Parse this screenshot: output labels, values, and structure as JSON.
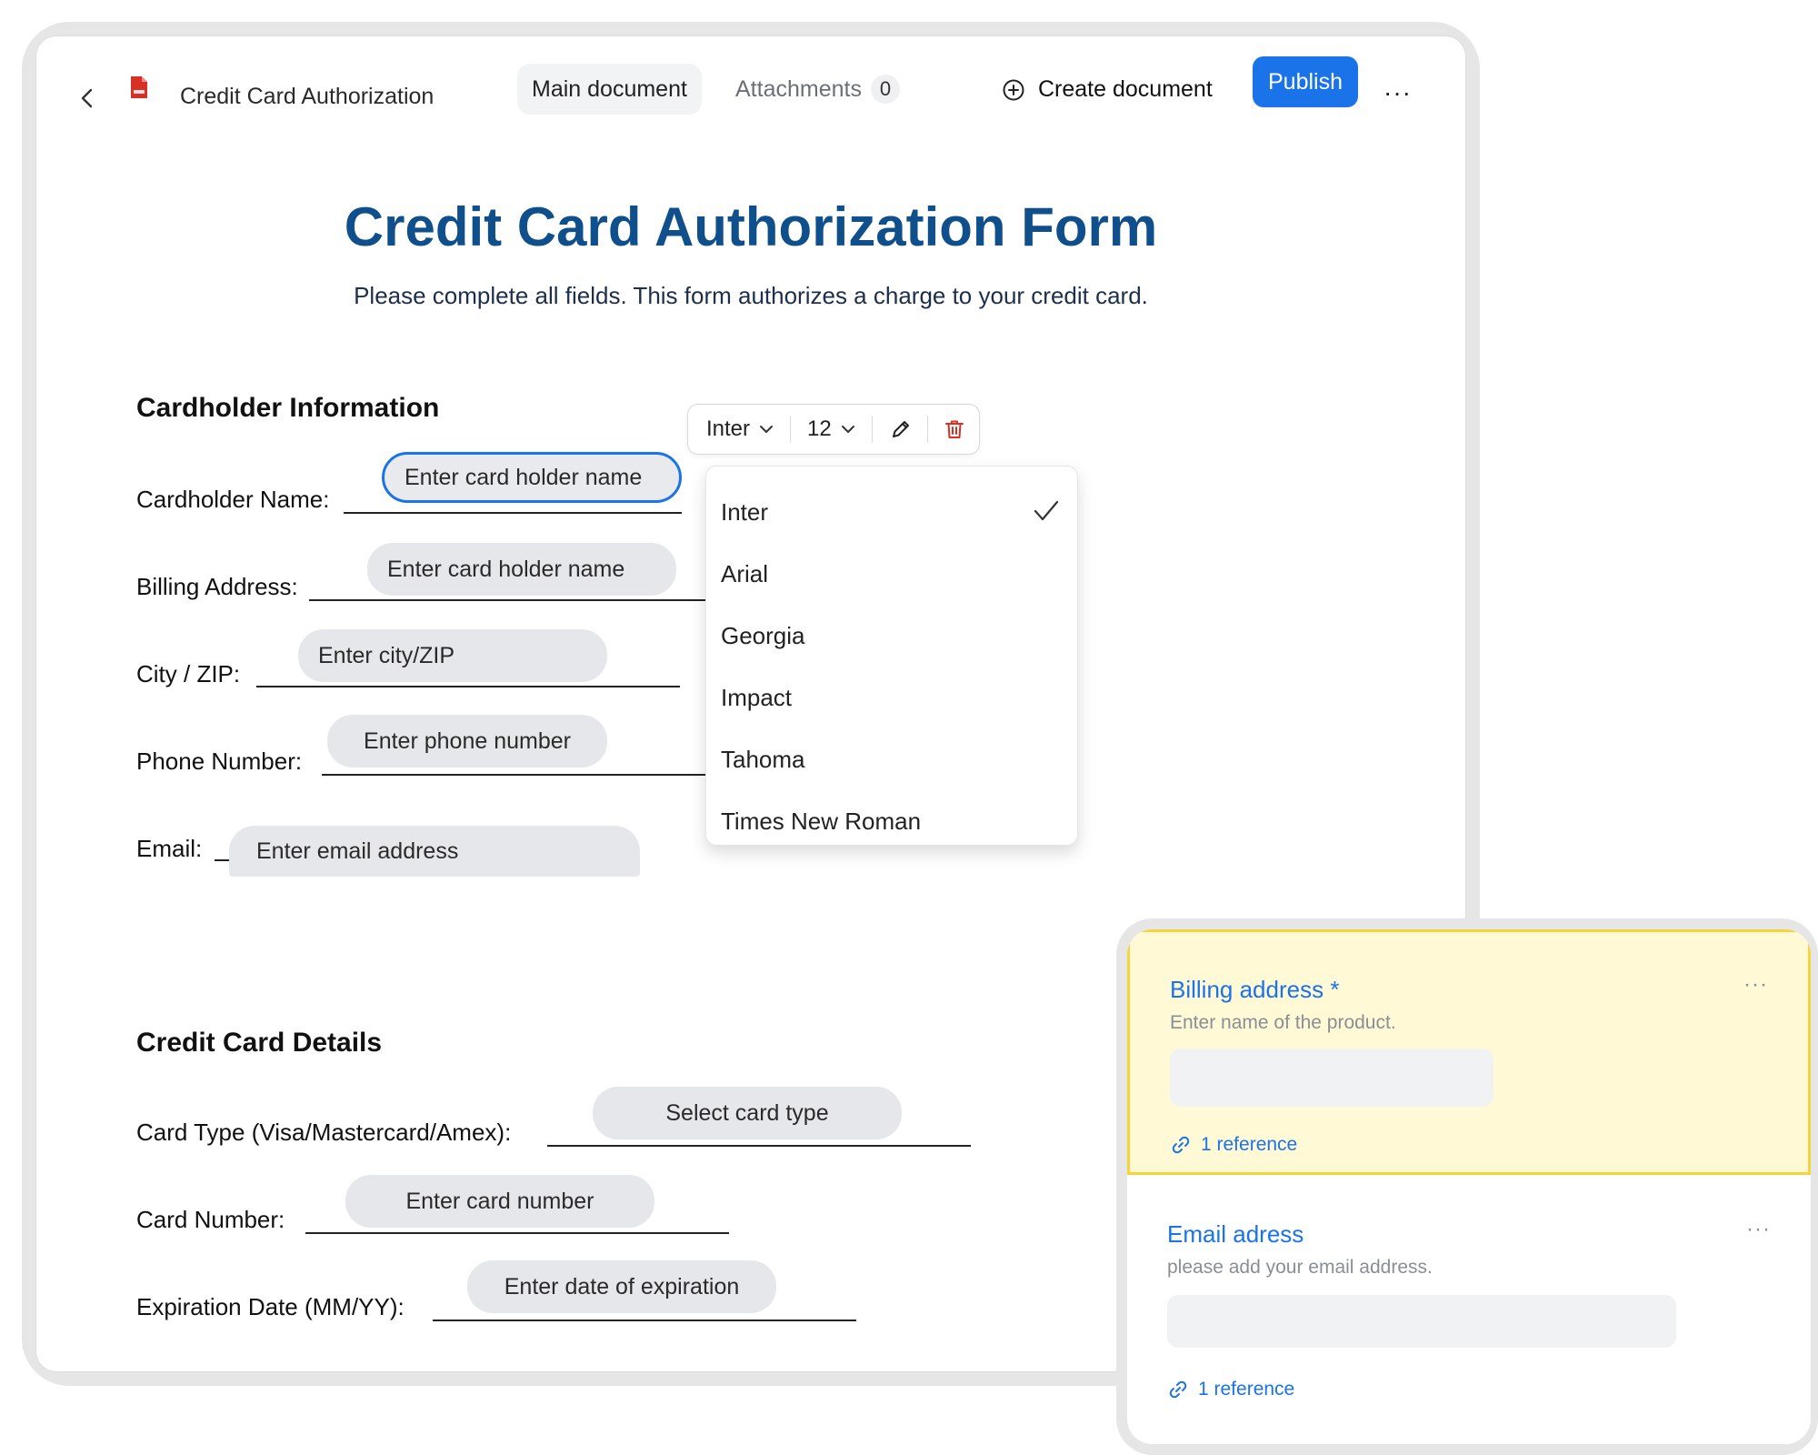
{
  "toolbar": {
    "doc_title": "Credit Card Authorization",
    "tab_main": "Main document",
    "tab_attachments": "Attachments",
    "attachments_count": "0",
    "create_document": "Create document",
    "publish": "Publish",
    "more": "···"
  },
  "document": {
    "title": "Credit Card Authorization Form",
    "subtitle": "Please complete all fields. This form authorizes a charge to your credit card.",
    "section_cardholder": "Cardholder Information",
    "section_card": "Credit Card Details",
    "fields": {
      "cardholder_name": {
        "label": "Cardholder Name:",
        "placeholder": "Enter card holder name"
      },
      "billing_address": {
        "label": "Billing Address:",
        "placeholder": "Enter card holder name"
      },
      "city_zip": {
        "label": "City / ZIP:",
        "placeholder": "Enter city/ZIP"
      },
      "phone": {
        "label": "Phone Number:",
        "placeholder": "Enter phone number"
      },
      "email": {
        "label": "Email:",
        "placeholder": "Enter email address"
      },
      "card_type": {
        "label": "Card Type (Visa/Mastercard/Amex):",
        "placeholder": "Select card type"
      },
      "card_number": {
        "label": "Card Number:",
        "placeholder": "Enter card number"
      },
      "expiration": {
        "label": "Expiration Date (MM/YY):",
        "placeholder": "Enter date of expiration"
      }
    }
  },
  "font_toolbar": {
    "font": "Inter",
    "size": "12",
    "options": [
      "Inter",
      "Arial",
      "Georgia",
      "Impact",
      "Tahoma",
      "Times New Roman"
    ],
    "selected": "Inter"
  },
  "panel": {
    "cards": [
      {
        "title": "Billing address *",
        "description": "Enter name of the product.",
        "reference": "1 reference"
      },
      {
        "title": "Email adress",
        "description": "please add your email address.",
        "reference": "1 reference"
      }
    ],
    "more": "···"
  },
  "colors": {
    "accent": "#1a73e8",
    "title_blue": "#0f4f8c",
    "highlight_bg": "#fff9d6",
    "highlight_border": "#f5d33b",
    "delete_red": "#d93025",
    "pdf_red": "#d93025"
  },
  "icons": {
    "back": "chevron-left-icon",
    "file": "pdf-file-icon",
    "create": "plus-circle-icon",
    "edit": "pencil-icon",
    "delete": "trash-icon",
    "check": "check-icon",
    "link": "link-icon"
  }
}
